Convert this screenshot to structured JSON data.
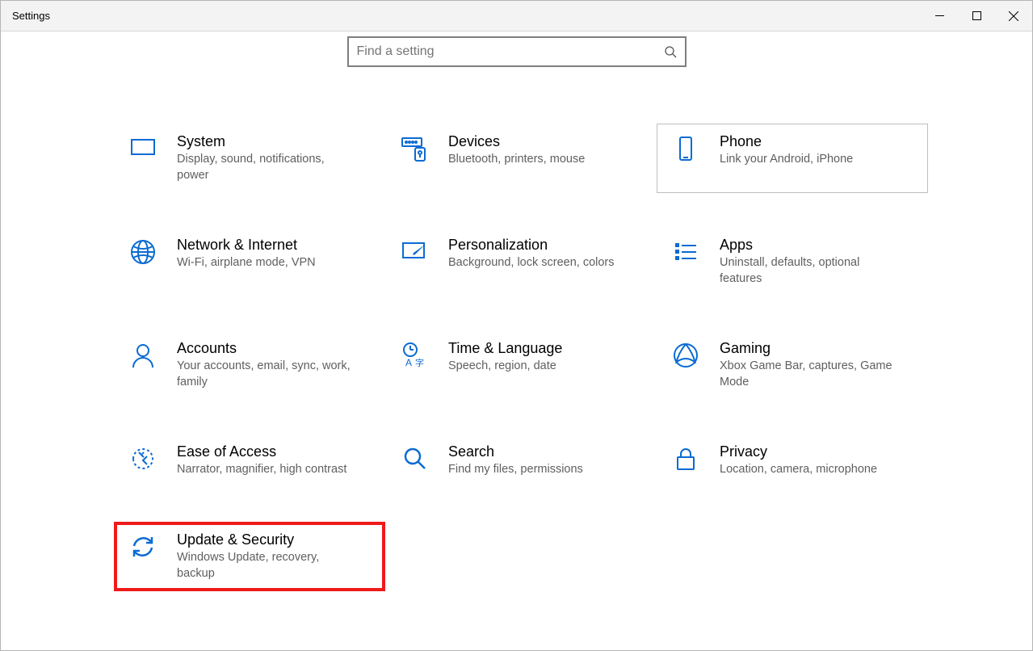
{
  "window": {
    "title": "Settings"
  },
  "search": {
    "placeholder": "Find a setting"
  },
  "tiles": {
    "system": {
      "title": "System",
      "sub": "Display, sound, notifications, power"
    },
    "devices": {
      "title": "Devices",
      "sub": "Bluetooth, printers, mouse"
    },
    "phone": {
      "title": "Phone",
      "sub": "Link your Android, iPhone"
    },
    "network": {
      "title": "Network & Internet",
      "sub": "Wi-Fi, airplane mode, VPN"
    },
    "personalization": {
      "title": "Personalization",
      "sub": "Background, lock screen, colors"
    },
    "apps": {
      "title": "Apps",
      "sub": "Uninstall, defaults, optional features"
    },
    "accounts": {
      "title": "Accounts",
      "sub": "Your accounts, email, sync, work, family"
    },
    "timelang": {
      "title": "Time & Language",
      "sub": "Speech, region, date"
    },
    "gaming": {
      "title": "Gaming",
      "sub": "Xbox Game Bar, captures, Game Mode"
    },
    "ease": {
      "title": "Ease of Access",
      "sub": "Narrator, magnifier, high contrast"
    },
    "searchcat": {
      "title": "Search",
      "sub": "Find my files, permissions"
    },
    "privacy": {
      "title": "Privacy",
      "sub": "Location, camera, microphone"
    },
    "update": {
      "title": "Update & Security",
      "sub": "Windows Update, recovery, backup"
    }
  }
}
